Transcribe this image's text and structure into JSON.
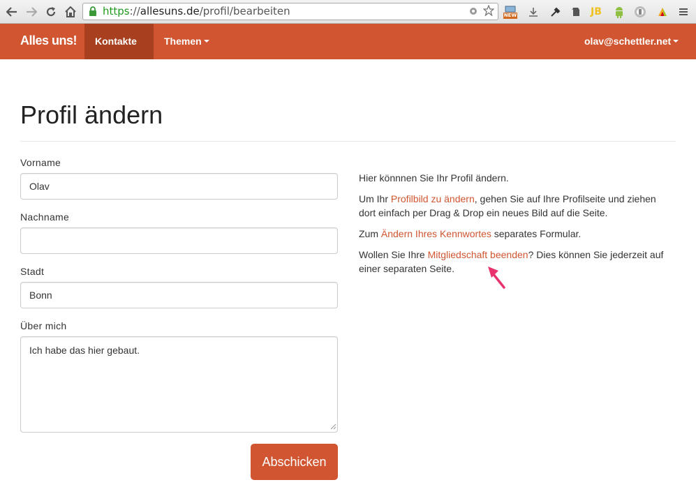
{
  "browser": {
    "url_scheme": "https",
    "url_sep": "://",
    "url_host": "allesuns.de",
    "url_path": "/profil/bearbeiten",
    "icons": [
      "back-icon",
      "forward-icon",
      "reload-icon",
      "home-icon",
      "lock-icon",
      "settings-icon",
      "star-icon",
      "new-extension-icon",
      "download-icon",
      "eyedropper-icon",
      "evernote-icon",
      "jb-icon",
      "android-icon",
      "adblock-icon",
      "color-picker-icon",
      "menu-icon"
    ],
    "new_badge": "NEW",
    "jb_label": "JB"
  },
  "navbar": {
    "brand": "Alles uns!",
    "items": [
      {
        "label": "Kontakte",
        "active": true
      },
      {
        "label": "Themen",
        "active": false
      }
    ],
    "user": "olav@schettler.net"
  },
  "page": {
    "title": "Profil ändern"
  },
  "form": {
    "vorname_label": "Vorname",
    "vorname_value": "Olav",
    "nachname_label": "Nachname",
    "nachname_value": "",
    "stadt_label": "Stadt",
    "stadt_value": "Bonn",
    "about_label": "Über mich",
    "about_value": "Ich habe das hier gebaut.",
    "submit_label": "Abschicken"
  },
  "side": {
    "p1": "Hier könnnen Sie Ihr Profil ändern.",
    "p2_pre": "Um Ihr ",
    "p2_link": "Profilbild zu ändern",
    "p2_post": ", gehen Sie auf Ihre Profilseite und ziehen dort einfach per Drag & Drop ein neues Bild auf die Seite.",
    "p3_pre": "Zum ",
    "p3_link": "Ändern Ihres Kennwortes",
    "p3_post": " separates Formular.",
    "p4_pre": "Wollen Sie Ihre ",
    "p4_link": "Mitgliedschaft beenden",
    "p4_post": "? Dies können Sie jederzeit auf einer separaten Seite."
  },
  "colors": {
    "brand": "#d05530",
    "brand_active": "#a8401f",
    "annotation_arrow": "#e8336d"
  }
}
